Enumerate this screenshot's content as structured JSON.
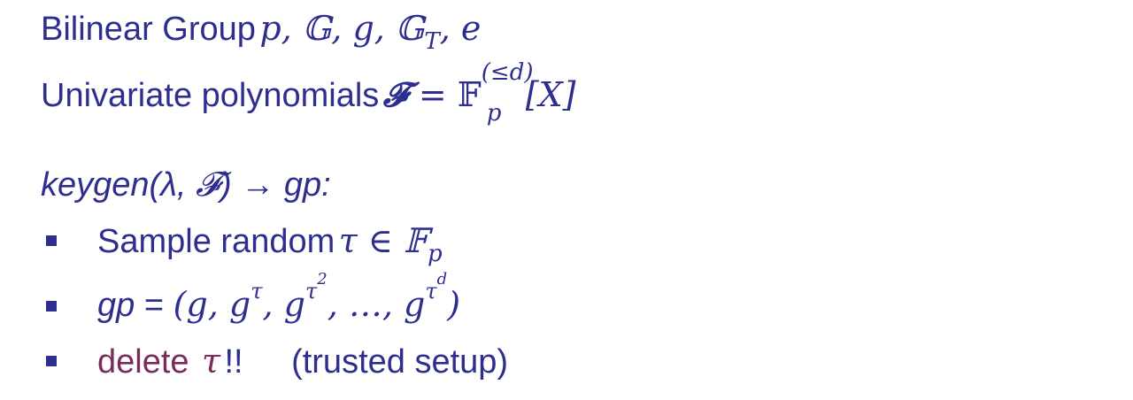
{
  "line1": {
    "label": "Bilinear Group",
    "math": "p, 𝔾, g, 𝔾",
    "sub": "T",
    "tail": ", e"
  },
  "line2": {
    "label": "Univariate polynomials",
    "F": "𝓕",
    "eq": " = ",
    "field": "𝔽",
    "sup": "(≤d)",
    "sub": "p",
    "tail": "[X]"
  },
  "line3": {
    "text": "keygen(λ, 𝓕) → gp:"
  },
  "bullets": [
    {
      "label": "Sample random",
      "math": "τ ∈ 𝔽",
      "sub": "p"
    },
    {
      "label": "gp",
      "eq": " = ",
      "math": "(g, g",
      "sup1": "τ",
      "mid1": ", g",
      "sup2": "τ",
      "sup2b": "2",
      "mid2": ", …, g",
      "sup3": "τ",
      "sup3b": "d",
      "close": ")"
    },
    {
      "label": "delete",
      "math": "τ",
      "bang": "!!",
      "note": "(trusted setup)"
    }
  ]
}
